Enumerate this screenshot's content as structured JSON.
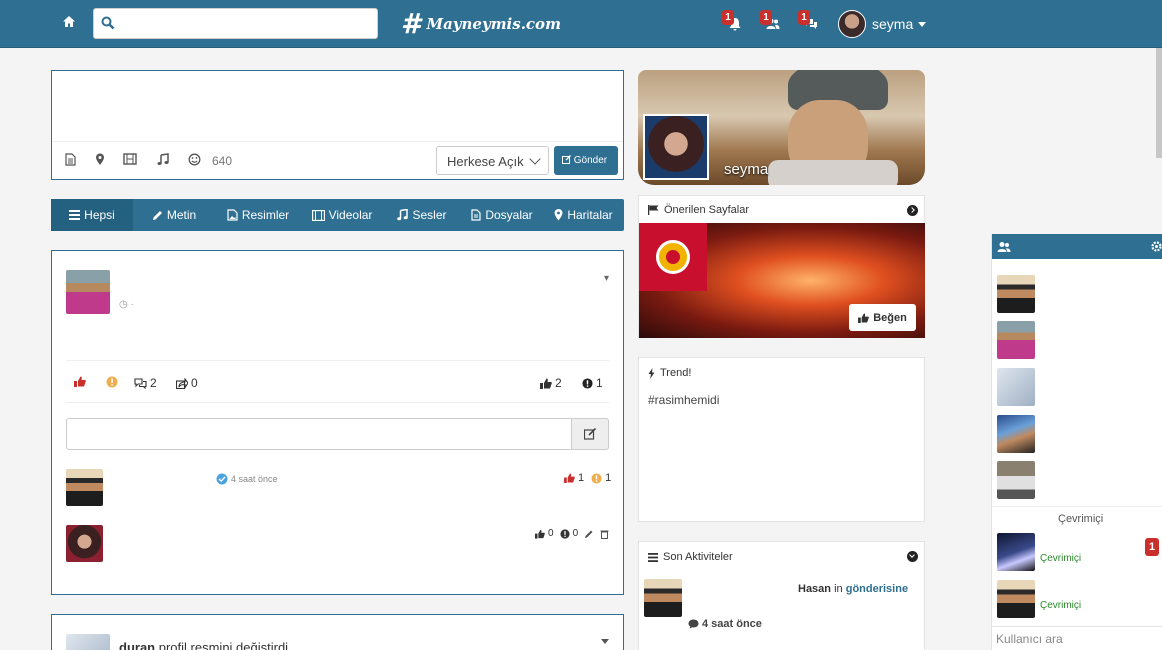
{
  "navbar": {
    "brand_name": "Mayneymis.com",
    "brand_hash": "#",
    "search_placeholder": "",
    "notif_count": "1",
    "friend_count": "1",
    "message_count": "1",
    "username": "seyma"
  },
  "composer": {
    "placeholder": "",
    "char_count": "640",
    "privacy": "Herkese Açık",
    "send_label": "Gönder"
  },
  "tabs": [
    {
      "label": "Hepsi",
      "icon": "list-icon"
    },
    {
      "label": "Metin",
      "icon": "pencil-icon"
    },
    {
      "label": "Resimler",
      "icon": "image-icon"
    },
    {
      "label": "Videolar",
      "icon": "film-icon"
    },
    {
      "label": "Sesler",
      "icon": "music-icon"
    },
    {
      "label": "Dosyalar",
      "icon": "file-icon"
    },
    {
      "label": "Haritalar",
      "icon": "map-marker-icon"
    }
  ],
  "post1": {
    "comments": "2",
    "shares": "0",
    "likes": "2",
    "reports": "1",
    "comment_placeholder": "",
    "comment1": {
      "time": "4 saat önce",
      "likes": "1",
      "reports": "1"
    },
    "comment2": {
      "likes": "0",
      "reports": "0"
    }
  },
  "post2": {
    "author": "duran",
    "action": "profil resmini değiştirdi"
  },
  "profile": {
    "name": "seyma"
  },
  "suggested": {
    "title": "Önerilen Sayfalar",
    "like_label": "Beğen"
  },
  "trend": {
    "title": "Trend!",
    "tag": "#rasimhemidi"
  },
  "activity": {
    "title": "Son Aktiviteler",
    "user": "Hasan",
    "in": "in",
    "target": "gönderisine",
    "time": "4 saat önce"
  },
  "chat": {
    "section_label": "Çevrimiçi",
    "online_label": "Çevrimiçi",
    "badge": "1",
    "search_placeholder": "Kullanıcı ara"
  },
  "colors": {
    "primary": "#2e6f92",
    "danger": "#c9302c",
    "warning": "#f0ad4e"
  }
}
